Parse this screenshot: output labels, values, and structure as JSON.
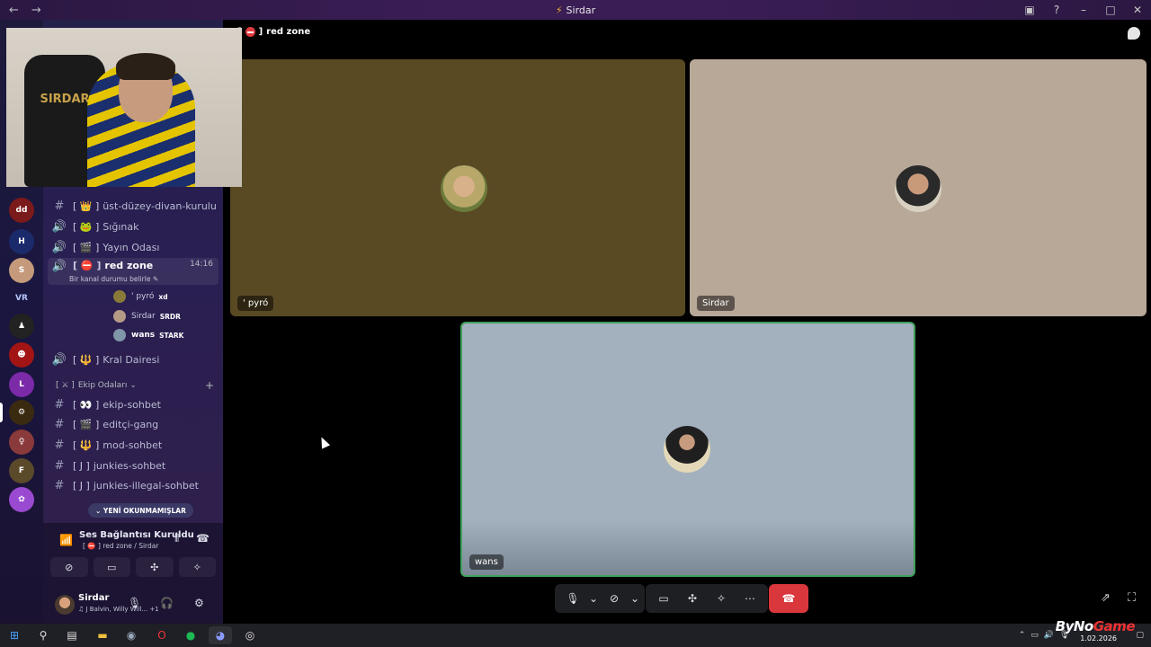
{
  "titlebar": {
    "title": "Sirdar",
    "back": "←",
    "forward": "→"
  },
  "channels": [
    {
      "type": "text",
      "icon": "#",
      "emoji": "👑",
      "name": "üst-düzey-divan-kurulu"
    },
    {
      "type": "voice",
      "icon": "🔊",
      "emoji": "🐸",
      "name": "Sığınak"
    },
    {
      "type": "voice",
      "icon": "🔊",
      "emoji": "🎬",
      "name": "Yayın Odası"
    },
    {
      "type": "voice",
      "icon": "🔊",
      "emoji": "⛔",
      "name": "red zone",
      "time": "14:16",
      "active": true
    },
    {
      "type": "voice",
      "icon": "🔊",
      "emoji": "🔱",
      "name": "Kral Dairesi"
    }
  ],
  "active_channel": {
    "status_hint": "Bir kanal durumu belirle",
    "users": [
      {
        "name": "' pyró",
        "tag": "xd"
      },
      {
        "name": "Sirdar",
        "tag": "SRDR"
      },
      {
        "name": "wans",
        "tag": "STARK"
      }
    ]
  },
  "category": {
    "label": "Ekip Odaları",
    "channels": [
      {
        "icon": "#",
        "emoji": "👀",
        "name": "ekip-sohbet"
      },
      {
        "icon": "#",
        "emoji": "🎬",
        "name": "editçi-gang"
      },
      {
        "icon": "#",
        "emoji": "🔱",
        "name": "mod-sohbet"
      },
      {
        "icon": "#",
        "emoji": "J",
        "name": "junkies-sohbet"
      },
      {
        "icon": "#",
        "emoji": "J",
        "name": "junkies-illegal-sohbet"
      }
    ]
  },
  "unread_label": "YENİ OKUNMAMIŞLAR",
  "voice_panel": {
    "status": "Ses Bağlantısı Kuruldu",
    "location": "red zone / Sirdar"
  },
  "user_panel": {
    "name": "Sirdar",
    "activity": "J Balvin, Willy Will...",
    "extra": "+1"
  },
  "stage": {
    "channel_name": "red zone",
    "tiles": [
      {
        "name": "' pyró",
        "bg": "#5a4a24"
      },
      {
        "name": "Sirdar",
        "bg": "#b8a898"
      },
      {
        "name": "wans",
        "bg": "#a3b1bf"
      }
    ]
  },
  "taskbar": {
    "date": "1.02.2026",
    "brand_a": "ByNo",
    "brand_b": "Game"
  },
  "webcam": {
    "chair_label": "SIRDAR"
  }
}
